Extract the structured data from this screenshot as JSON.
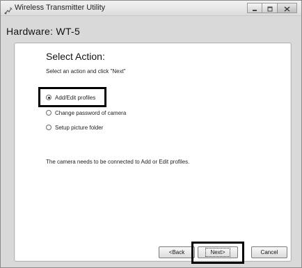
{
  "window": {
    "title": "Wireless Transmitter Utility",
    "icons": {
      "app": "wireless-app-icon",
      "minimize": "minimize-icon",
      "maximize": "maximize-icon",
      "close": "close-icon"
    }
  },
  "header": {
    "title": "Hardware: WT-5"
  },
  "panel": {
    "heading": "Select Action:",
    "instruction": "Select an action and click \"Next\"",
    "options": [
      {
        "label": "Add/Edit profiles",
        "selected": true
      },
      {
        "label": "Change password of camera",
        "selected": false
      },
      {
        "label": "Setup picture folder",
        "selected": false
      }
    ],
    "note": "The camera needs to be connected to Add or Edit profiles."
  },
  "buttons": {
    "back": "<Back",
    "next": "Next>",
    "cancel": "Cancel"
  },
  "colors": {
    "window_bg": "#d9d9d9",
    "panel_bg": "#ffffff",
    "highlight_border": "#000000"
  }
}
